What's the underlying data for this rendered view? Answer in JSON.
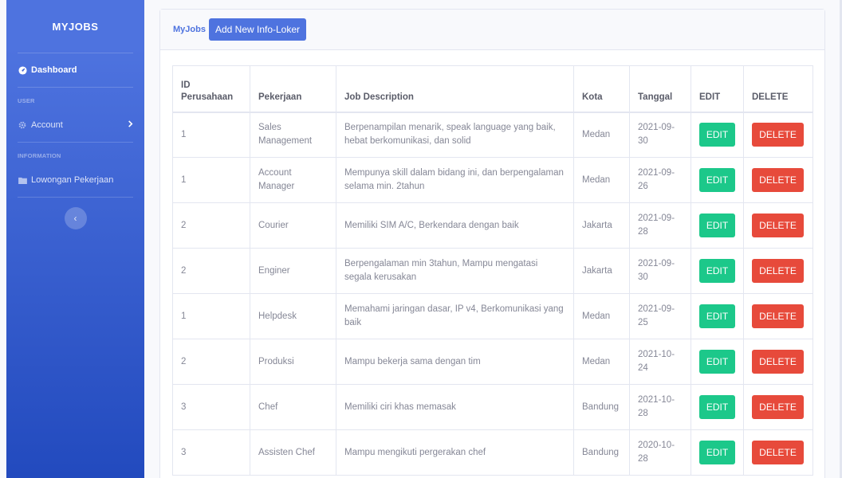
{
  "sidebar": {
    "brand": "MYJOBS",
    "dashboard_label": "Dashboard",
    "user_heading": "USER",
    "account_label": "Account",
    "info_heading": "INFORMATION",
    "lowongan_label": "Lowongan Pekerjaan",
    "toggle_glyph": "‹"
  },
  "card": {
    "title": "MyJobs",
    "add_button": "Add New Info-Loker"
  },
  "table": {
    "headers": [
      "ID Perusahaan",
      "Pekerjaan",
      "Job Description",
      "Kota",
      "Tanggal",
      "EDIT",
      "DELETE"
    ],
    "edit_label": "EDIT",
    "delete_label": "DELETE",
    "rows": [
      {
        "id": "1",
        "pekerjaan": "Sales Management",
        "desc": "Berpenampilan menarik, speak language yang baik, hebat berkomunikasi, dan solid",
        "kota": "Medan",
        "tanggal": "2021-09-30"
      },
      {
        "id": "1",
        "pekerjaan": "Account Manager",
        "desc": "Mempunya skill dalam bidang ini, dan berpengalaman selama min. 2tahun",
        "kota": "Medan",
        "tanggal": "2021-09-26"
      },
      {
        "id": "2",
        "pekerjaan": "Courier",
        "desc": "Memiliki SIM A/C, Berkendara dengan baik",
        "kota": "Jakarta",
        "tanggal": "2021-09-28"
      },
      {
        "id": "2",
        "pekerjaan": "Enginer",
        "desc": "Berpengalaman min 3tahun, Mampu mengatasi segala kerusakan",
        "kota": "Jakarta",
        "tanggal": "2021-09-30"
      },
      {
        "id": "1",
        "pekerjaan": "Helpdesk",
        "desc": "Memahami jaringan dasar, IP v4, Berkomunikasi yang baik",
        "kota": "Medan",
        "tanggal": "2021-09-25"
      },
      {
        "id": "2",
        "pekerjaan": "Produksi",
        "desc": "Mampu bekerja sama dengan tim",
        "kota": "Medan",
        "tanggal": "2021-10-24"
      },
      {
        "id": "3",
        "pekerjaan": "Chef",
        "desc": "Memiliki ciri khas memasak",
        "kota": "Bandung",
        "tanggal": "2021-10-28"
      },
      {
        "id": "3",
        "pekerjaan": "Assisten Chef",
        "desc": "Mampu mengikuti pergerakan chef",
        "kota": "Bandung",
        "tanggal": "2020-10-28"
      }
    ]
  },
  "colors": {
    "primary": "#4e73df",
    "success": "#1cc88a",
    "danger": "#e74a3b"
  }
}
